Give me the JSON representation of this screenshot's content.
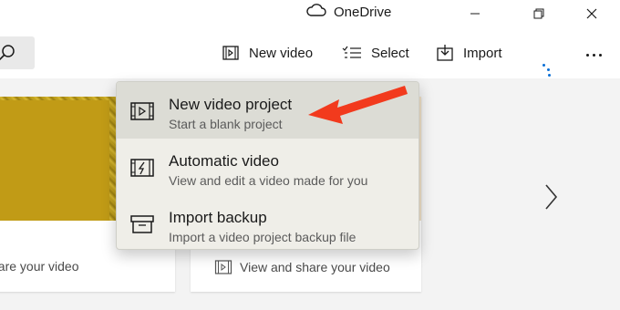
{
  "window": {
    "title": "OneDrive"
  },
  "toolbar": {
    "new_video_label": "New video",
    "select_label": "Select",
    "import_label": "Import"
  },
  "menu": {
    "items": [
      {
        "title": "New video project",
        "subtitle": "Start a blank project",
        "icon": "video-project-icon"
      },
      {
        "title": "Automatic video",
        "subtitle": "View and edit a video made for you",
        "icon": "automatic-video-icon"
      },
      {
        "title": "Import backup",
        "subtitle": "Import a video project backup file",
        "icon": "archive-box-icon"
      }
    ]
  },
  "cards": [
    {
      "caption": "hare your video"
    },
    {
      "caption": "View and share your video"
    }
  ],
  "colors": {
    "accent": "#0a6fd6",
    "annotation_arrow": "#f23a1d",
    "menu_background": "#efeee8",
    "menu_highlight": "#dcdcd5"
  }
}
